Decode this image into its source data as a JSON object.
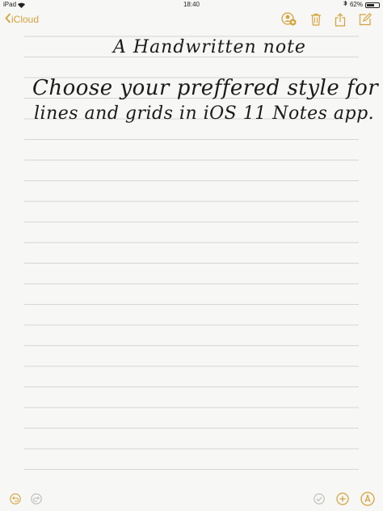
{
  "status": {
    "device": "iPad",
    "time": "18:40",
    "battery": "62%",
    "battery_fraction": 0.62
  },
  "nav": {
    "back_label": "iCloud",
    "icons": [
      "add-people-icon",
      "trash-icon",
      "share-icon",
      "compose-icon"
    ]
  },
  "note": {
    "title": "A Handwritten note",
    "line1": "Choose your preffered style for",
    "line2": "lines and grids in iOS 11 Notes app."
  },
  "toolbar": {
    "icons": [
      "undo-icon",
      "redo-icon",
      "checkmark-icon",
      "add-icon",
      "pen-tool-icon"
    ]
  },
  "colors": {
    "accent": "#d4a23a",
    "line": "#d5d6d6",
    "background": "#f7f7f5"
  }
}
